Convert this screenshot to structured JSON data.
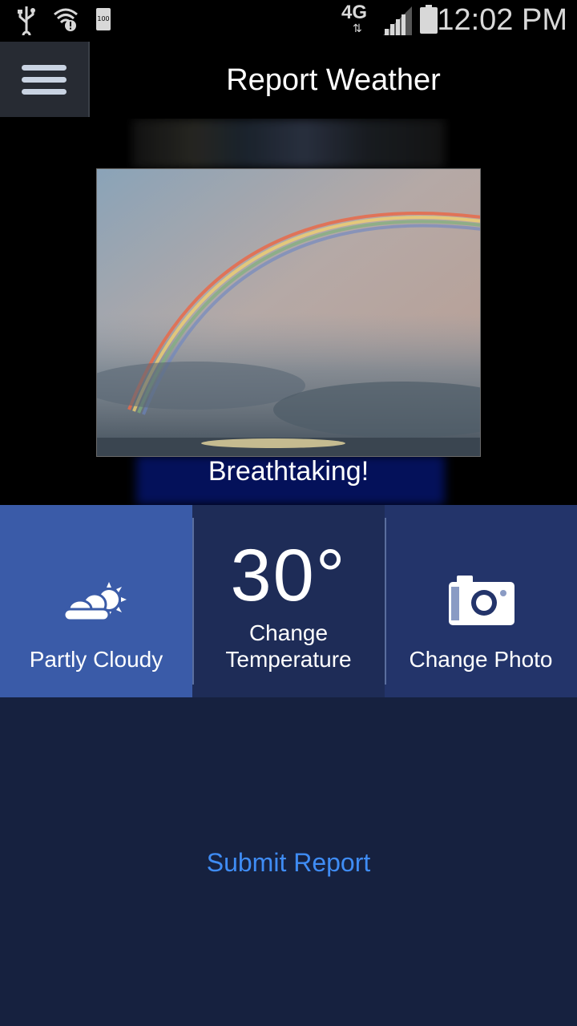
{
  "status_bar": {
    "time": "12:02 PM",
    "battery_text": "100",
    "network_label": "4G",
    "icons": [
      "usb-icon",
      "wifi-alert-icon",
      "battery-saver-icon",
      "lte-icon",
      "signal-icon",
      "battery-icon"
    ]
  },
  "header": {
    "title": "Report Weather",
    "menu_icon": "hamburger-menu-icon"
  },
  "photo": {
    "caption": "Breathtaking!"
  },
  "tiles": {
    "condition": {
      "label": "Partly Cloudy",
      "icon": "partly-cloudy-icon"
    },
    "temperature": {
      "value": "30°",
      "label_line1": "Change",
      "label_line2": "Temperature"
    },
    "photo": {
      "label": "Change Photo",
      "icon": "camera-icon"
    }
  },
  "actions": {
    "submit_label": "Submit Report"
  },
  "colors": {
    "background": "#16213f",
    "tile": "#23346a",
    "tile_active": "#3a5ba8",
    "submit_link": "#3f8cf4"
  }
}
